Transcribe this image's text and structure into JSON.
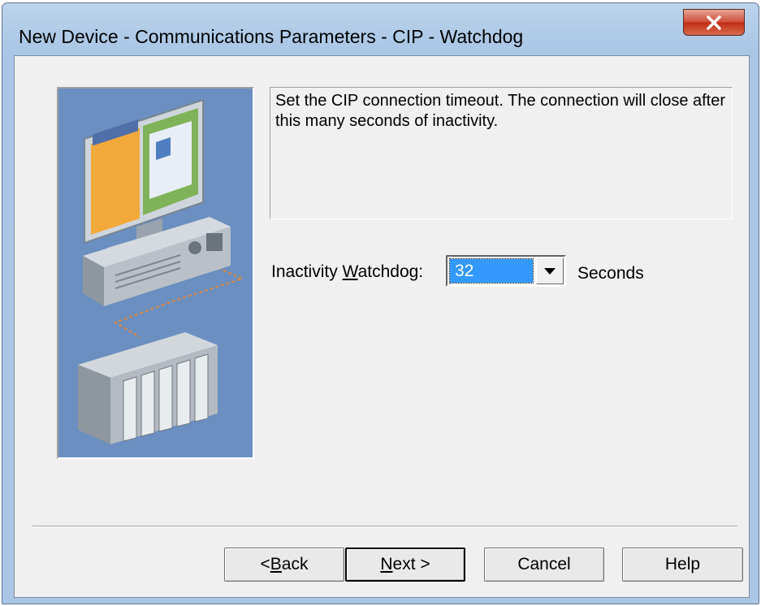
{
  "window": {
    "title": "New Device - Communications Parameters - CIP - Watchdog",
    "close_glyph": "X"
  },
  "description": "Set the CIP connection timeout.  The connection will close after this many seconds of inactivity.",
  "watchdog": {
    "label_prefix": "Inactivity ",
    "label_accel": "W",
    "label_rest": "atchdog:",
    "value": "32",
    "unit": "Seconds"
  },
  "buttons": {
    "back": {
      "prefix": "< ",
      "accel": "B",
      "rest": "ack"
    },
    "next": {
      "accel": "N",
      "rest": "ext >"
    },
    "cancel": "Cancel",
    "help": "Help"
  },
  "colors": {
    "illustration_bg": "#6a8fc0",
    "selection": "#3399ff",
    "close_button": "#c7381e"
  }
}
